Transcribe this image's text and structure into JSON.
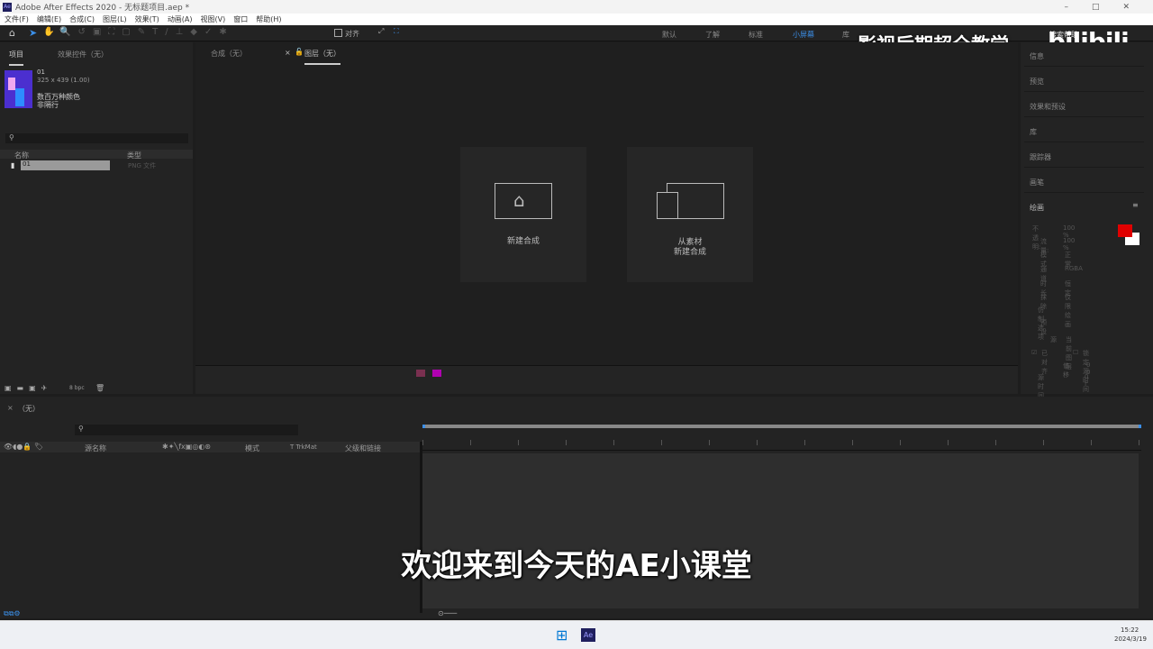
{
  "window": {
    "title": "Adobe After Effects 2020 - 无标题项目.aep *",
    "app_badge": "Ae"
  },
  "menu": [
    "文件(F)",
    "编辑(E)",
    "合成(C)",
    "图层(L)",
    "效果(T)",
    "动画(A)",
    "视图(V)",
    "窗口",
    "帮助(H)"
  ],
  "toolbar": {
    "align_label": "对齐"
  },
  "workspaces": [
    "默认",
    "了解",
    "标准",
    "小屏幕",
    "库"
  ],
  "active_workspace": "小屏幕",
  "search_help": "搜索帮助",
  "watermark": {
    "text": "影视后期超全教学",
    "logo": "bilibili"
  },
  "project_panel": {
    "tabs": [
      "项目",
      "效果控件（无）"
    ],
    "item_name": "01",
    "dims": "325 x 439 (1.00)",
    "desc1": "数百万种颜色",
    "desc2": "非隔行",
    "col_name": "名称",
    "col_type": "类型",
    "rows": [
      {
        "name": "01",
        "type": "PNG 文件"
      }
    ],
    "bpc": "8 bpc"
  },
  "viewer": {
    "tabs": [
      "合成（无）",
      "图层（无）"
    ],
    "cards": [
      {
        "label": "新建合成"
      },
      {
        "label1": "从素材",
        "label2": "新建合成"
      }
    ]
  },
  "right_panels": [
    "信息",
    "预览",
    "效果和预设",
    "库",
    "跟踪器",
    "画笔",
    "绘画"
  ],
  "paint": {
    "opacity_label": "不透明:",
    "opacity": "100 %",
    "flow_label": "流量:",
    "flow": "100 %",
    "mode_label": "模式",
    "mode": "正常",
    "channel_label": "通道",
    "channel": "RGBA",
    "duration_label": "时长",
    "duration": "恒定",
    "erase_label": "抹除",
    "erase": "仅限绘画",
    "clone_label": "仿制选项",
    "preset_label": "预设",
    "source_label": "源",
    "source": "当前图层",
    "aligned": "已对齐",
    "lock_source": "锁定源时间",
    "offset_label": "偏移",
    "offset": "0   0",
    "source_time_label": "源时间转移",
    "source_time": "0 f",
    "color_fg": "#e00000",
    "color_bg": "#ffffff"
  },
  "timeline": {
    "tab": "（无）",
    "col_source": "源名称",
    "col_mode": "模式",
    "col_trkmat": "T  TrkMat",
    "col_parent": "父级和链接"
  },
  "subtitle": "欢迎来到今天的AE小课堂",
  "taskbar": {
    "time": "15:22",
    "date": "2024/3/19"
  }
}
